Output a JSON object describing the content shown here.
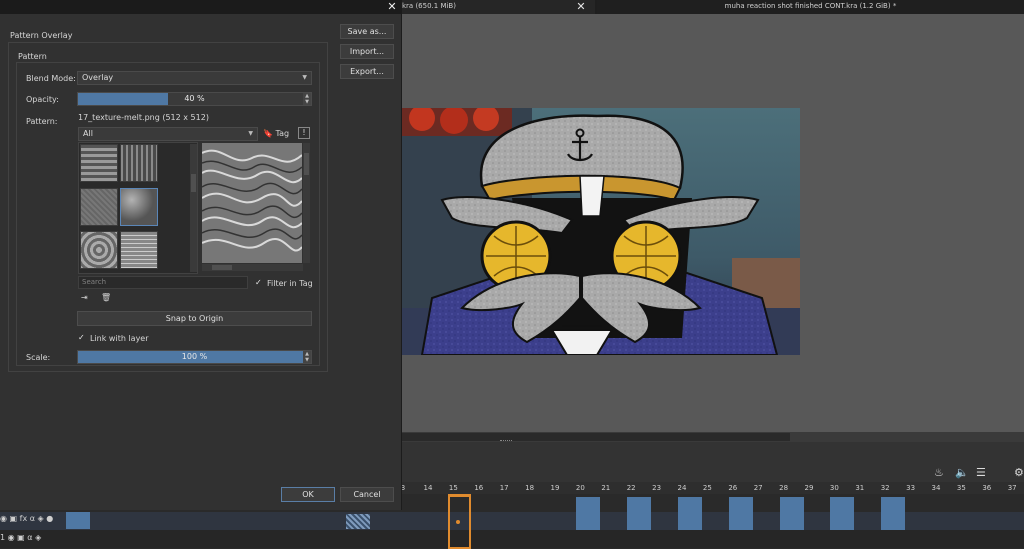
{
  "window": {
    "tabs": [
      {
        "label": "kra (650.1 MiB)"
      },
      {
        "label": "muha reaction shot finished CONT.kra (1.2 GiB) *"
      }
    ]
  },
  "dialog": {
    "section_title": "Pattern Overlay",
    "group_title": "Pattern",
    "blend_mode_label": "Blend Mode:",
    "blend_mode_value": "Overlay",
    "opacity_label": "Opacity:",
    "opacity_value": "40 %",
    "opacity_fraction": 0.4,
    "pattern_label": "Pattern:",
    "pattern_file": "17_texture-melt.png (512 x 512)",
    "filter_value": "All",
    "tag_label": "Tag",
    "search_placeholder": "Search",
    "filter_in_tag_label": "Filter in Tag",
    "snap_button": "Snap to Origin",
    "link_layer_label": "Link with layer",
    "scale_label": "Scale:",
    "scale_value": "100 %",
    "scale_fraction": 1.0,
    "save_as_button": "Save as...",
    "import_button": "Import...",
    "export_button": "Export...",
    "ok_button": "OK",
    "cancel_button": "Cancel"
  },
  "timeline": {
    "frames": [
      "3",
      "14",
      "15",
      "16",
      "17",
      "18",
      "19",
      "20",
      "21",
      "22",
      "23",
      "24",
      "25",
      "26",
      "27",
      "28",
      "29",
      "30",
      "31",
      "32",
      "33",
      "34",
      "35",
      "36",
      "37"
    ],
    "current_frame": "15",
    "layer_row_label": "1"
  },
  "colors": {
    "accent": "#4f78a4",
    "playhead": "#e08b2e"
  }
}
